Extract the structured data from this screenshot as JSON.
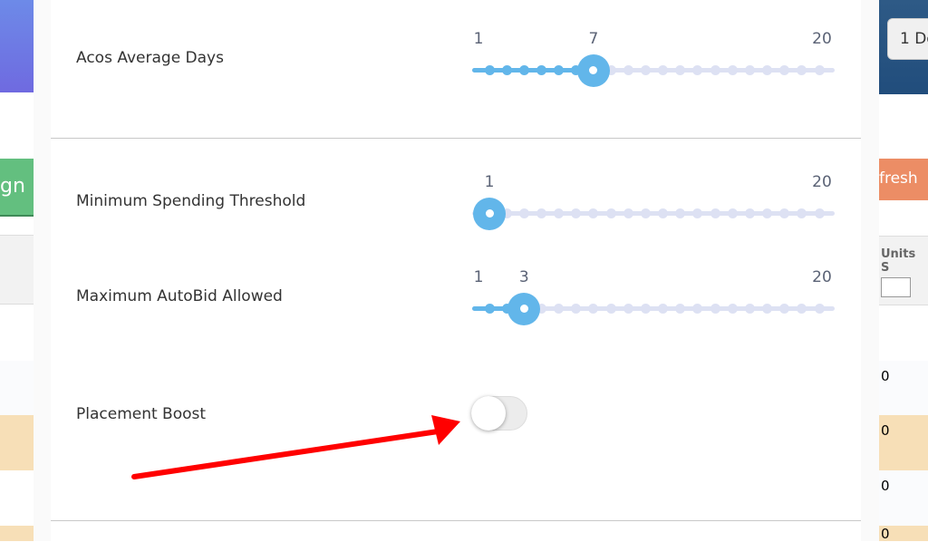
{
  "background": {
    "left_button": "gn",
    "right_date_button": "1 De",
    "refresh_button": "fresh",
    "units_header": "Units S",
    "row_values": [
      "0",
      "0",
      "0",
      "0"
    ]
  },
  "settings": [
    {
      "label": "Acos Average Days",
      "min": 1,
      "max": 20,
      "value": 7
    },
    {
      "label": "Minimum Spending Threshold",
      "min": 1,
      "max": 20,
      "value": 1
    },
    {
      "label": "Maximum AutoBid Allowed",
      "min": 1,
      "max": 20,
      "value": 3
    }
  ],
  "placement_boost": {
    "label": "Placement Boost",
    "enabled": false
  },
  "colors": {
    "accent": "#62b6ea",
    "track": "#dde1f3",
    "annotation_arrow": "#ff0000"
  }
}
